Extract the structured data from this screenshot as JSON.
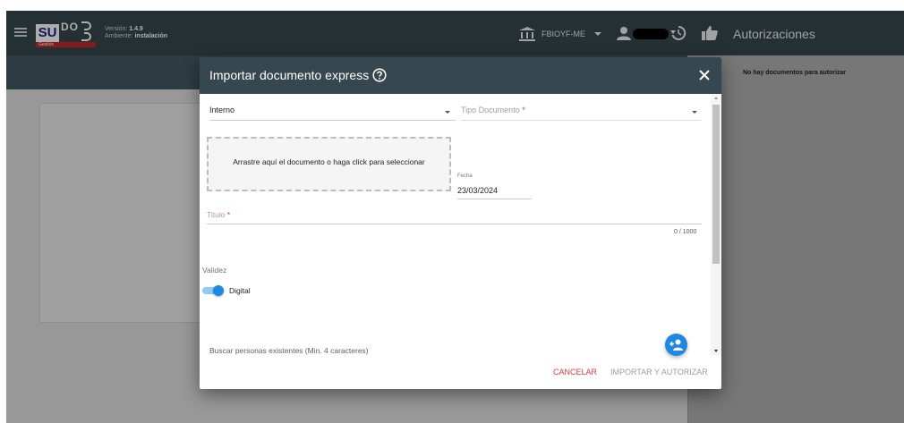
{
  "header": {
    "logo_text_su": "SU",
    "logo_text_dou": "DOU",
    "logo_subtitle": "Gestión",
    "version_label": "Versión:",
    "version_value": "1.4.9",
    "environment_label": "Ambiente:",
    "environment_value": "instalación",
    "organization": "FBIOYF-ME"
  },
  "right_panel": {
    "title": "Autorizaciones",
    "empty_message": "No hay documentos para autorizar"
  },
  "dialog": {
    "title": "Importar documento express",
    "origin_select": {
      "value": "Interno"
    },
    "doc_type_select": {
      "placeholder": "Tipo Documento",
      "required_mark": "*"
    },
    "dropzone_text": "Arrastre aquí el documento o haga click para seleccionar",
    "fecha": {
      "label": "Fecha",
      "value": "23/03/2024"
    },
    "titulo": {
      "placeholder": "Titulo",
      "required_mark": "*",
      "counter": "0 / 1000"
    },
    "validez": {
      "label": "Validez",
      "toggle_label": "Digital",
      "toggle_on": true
    },
    "search_placeholder": "Buscar personas existentes (Min. 4 caracteres)",
    "actions": {
      "cancel": "CANCELAR",
      "import": "IMPORTAR Y AUTORIZAR"
    }
  },
  "colors": {
    "header_bg": "#37474f",
    "accent_blue": "#1e88e5",
    "danger_red": "#e53935",
    "logo_red": "#c62828"
  }
}
